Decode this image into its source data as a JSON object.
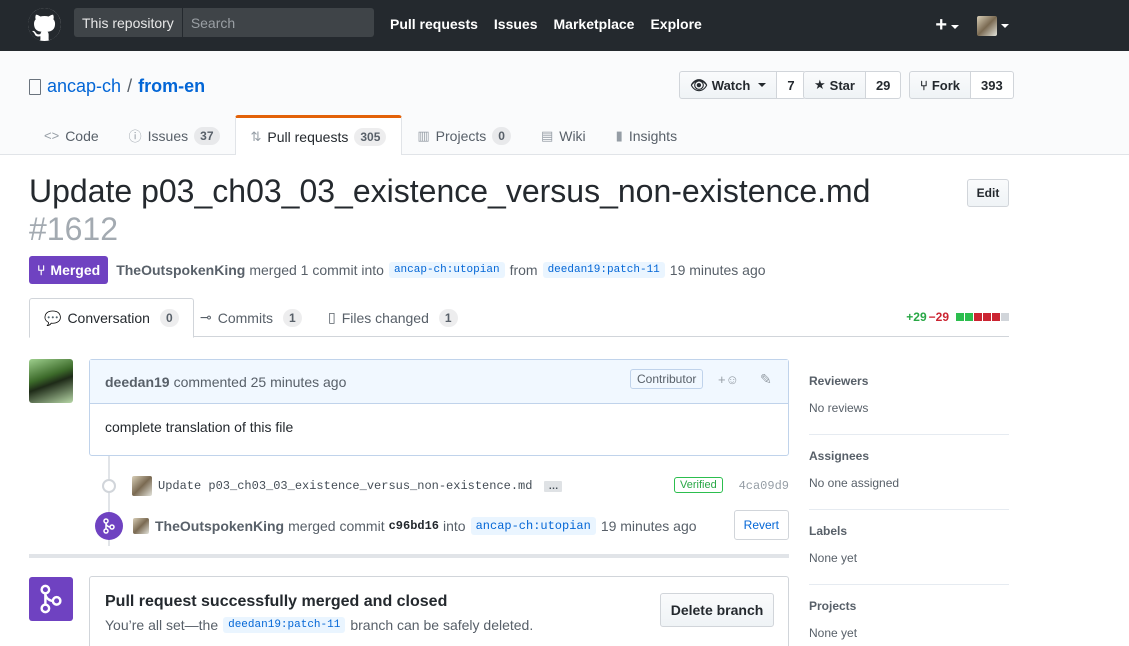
{
  "header": {
    "search_scope": "This repository",
    "search_placeholder": "Search",
    "nav": [
      "Pull requests",
      "Issues",
      "Marketplace",
      "Explore"
    ],
    "plus_icon": "plus-icon"
  },
  "repo": {
    "owner": "ancap-ch",
    "sep": "/",
    "name": "from-en",
    "watch_label": "Watch",
    "watch_count": "7",
    "star_label": "Star",
    "star_count": "29",
    "fork_label": "Fork",
    "fork_count": "393",
    "tabs": [
      {
        "label": "Code",
        "count": null,
        "icon": "code-icon"
      },
      {
        "label": "Issues",
        "count": "37",
        "icon": "issue-icon"
      },
      {
        "label": "Pull requests",
        "count": "305",
        "icon": "pr-icon"
      },
      {
        "label": "Projects",
        "count": "0",
        "icon": "project-icon"
      },
      {
        "label": "Wiki",
        "count": null,
        "icon": "wiki-icon"
      },
      {
        "label": "Insights",
        "count": null,
        "icon": "graph-icon"
      }
    ]
  },
  "pr": {
    "title": "Update p03_ch03_03_existence_versus_non-existence.md",
    "number": "#1612",
    "edit_label": "Edit",
    "state": "Merged",
    "author": "TheOutspokenKing",
    "meta_text1": "merged 1 commit into",
    "base_branch": "ancap-ch:utopian",
    "meta_text2": "from",
    "head_branch": "deedan19:patch-11",
    "meta_time": "19 minutes ago",
    "tabs": [
      {
        "label": "Conversation",
        "count": "0"
      },
      {
        "label": "Commits",
        "count": "1"
      },
      {
        "label": "Files changed",
        "count": "1"
      }
    ],
    "additions": "+29",
    "deletions": "−29",
    "diff_blocks": [
      "#2cbe4e",
      "#2cbe4e",
      "#cb2431",
      "#cb2431",
      "#cb2431",
      "#d1d5da"
    ]
  },
  "comment": {
    "author": "deedan19",
    "action": "commented 25 minutes ago",
    "badge": "Contributor",
    "reaction": "+☺",
    "edit_icon": "pencil-icon",
    "body": "complete translation of this file"
  },
  "commit": {
    "message": "Update p03_ch03_03_existence_versus_non-existence.md",
    "ellipsis": "…",
    "verified": "Verified",
    "sha": "4ca09d9"
  },
  "merge_event": {
    "author": "TheOutspokenKing",
    "text1": "merged commit",
    "sha": "c96bd16",
    "text2": "into",
    "branch": "ancap-ch:utopian",
    "time": "19 minutes ago",
    "revert_label": "Revert"
  },
  "merge_box": {
    "title": "Pull request successfully merged and closed",
    "text1": "You’re all set—the",
    "branch": "deedan19:patch-11",
    "text2": "branch can be safely deleted.",
    "delete_label": "Delete branch"
  },
  "sidebar": [
    {
      "heading": "Reviewers",
      "value": "No reviews"
    },
    {
      "heading": "Assignees",
      "value": "No one assigned"
    },
    {
      "heading": "Labels",
      "value": "None yet"
    },
    {
      "heading": "Projects",
      "value": "None yet"
    }
  ],
  "colors": {
    "header_bg": "#24292e",
    "merged": "#6f42c1",
    "link": "#0366d6",
    "tab_accent": "#e36209"
  }
}
